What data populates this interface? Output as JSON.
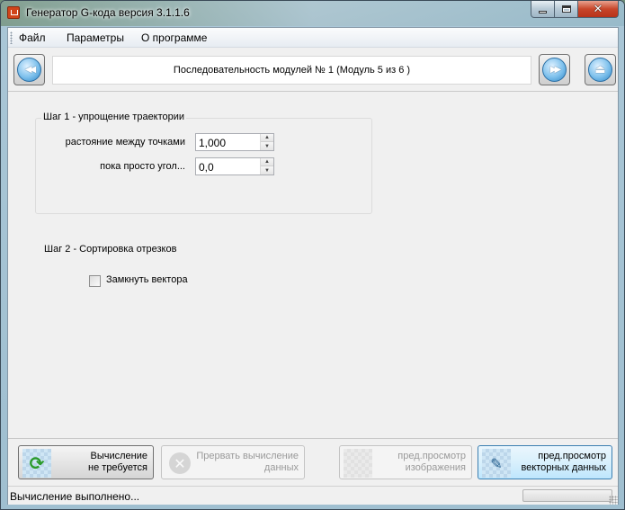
{
  "window": {
    "title": "Генератор G-кода версия 3.1.1.6",
    "app_icon": "app-icon",
    "caption_buttons": {
      "minimize_icon": "minimize-icon",
      "maximize_icon": "maximize-icon",
      "close_icon": "close-icon",
      "close_glyph": "✕"
    }
  },
  "menu": {
    "items": [
      "Файл",
      "Параметры",
      "О программе"
    ]
  },
  "navigation": {
    "back_icon": "rewind-icon",
    "back_glyph": "◀◀",
    "sequence_text": "Последовательность модулей № 1 (Модуль 5 из 6 )",
    "forward_icon": "fast-forward-icon",
    "forward_glyph": "▶▶",
    "eject_icon": "eject-icon",
    "eject_glyph": "⏏"
  },
  "step1": {
    "title": "Шаг 1 - упрощение траектории",
    "distance": {
      "label": "растояние между точками",
      "value": "1,000"
    },
    "angle": {
      "label": "пока просто угол...",
      "value": "0,0"
    }
  },
  "step2": {
    "title": "Шаг 2 - Сортировка отрезков",
    "close_vectors": {
      "label": "Замкнуть вектора",
      "checked": false
    }
  },
  "bottom_buttons": [
    {
      "label_line1": "Вычисление",
      "label_line2": "не требуется",
      "icon": "refresh-icon",
      "glyph": "⟳",
      "enabled": true
    },
    {
      "label_line1": "Прервать вычисление",
      "label_line2": "данных",
      "icon": "stop-icon",
      "glyph": "✕",
      "enabled": false
    },
    {
      "label_line1": "пред.просмотр",
      "label_line2": "изображения",
      "icon": "image-preview-icon",
      "glyph": "",
      "enabled": false
    },
    {
      "label_line1": "пред.просмотр",
      "label_line2": "векторных данных",
      "icon": "vector-preview-icon",
      "glyph": "✎",
      "enabled": true
    }
  ],
  "status": {
    "text": "Вычисление выполнено...",
    "progress": 0
  },
  "colors": {
    "accent_blue": "#2f86c6",
    "close_red": "#c8462a",
    "refresh_green": "#2a9a2a"
  }
}
